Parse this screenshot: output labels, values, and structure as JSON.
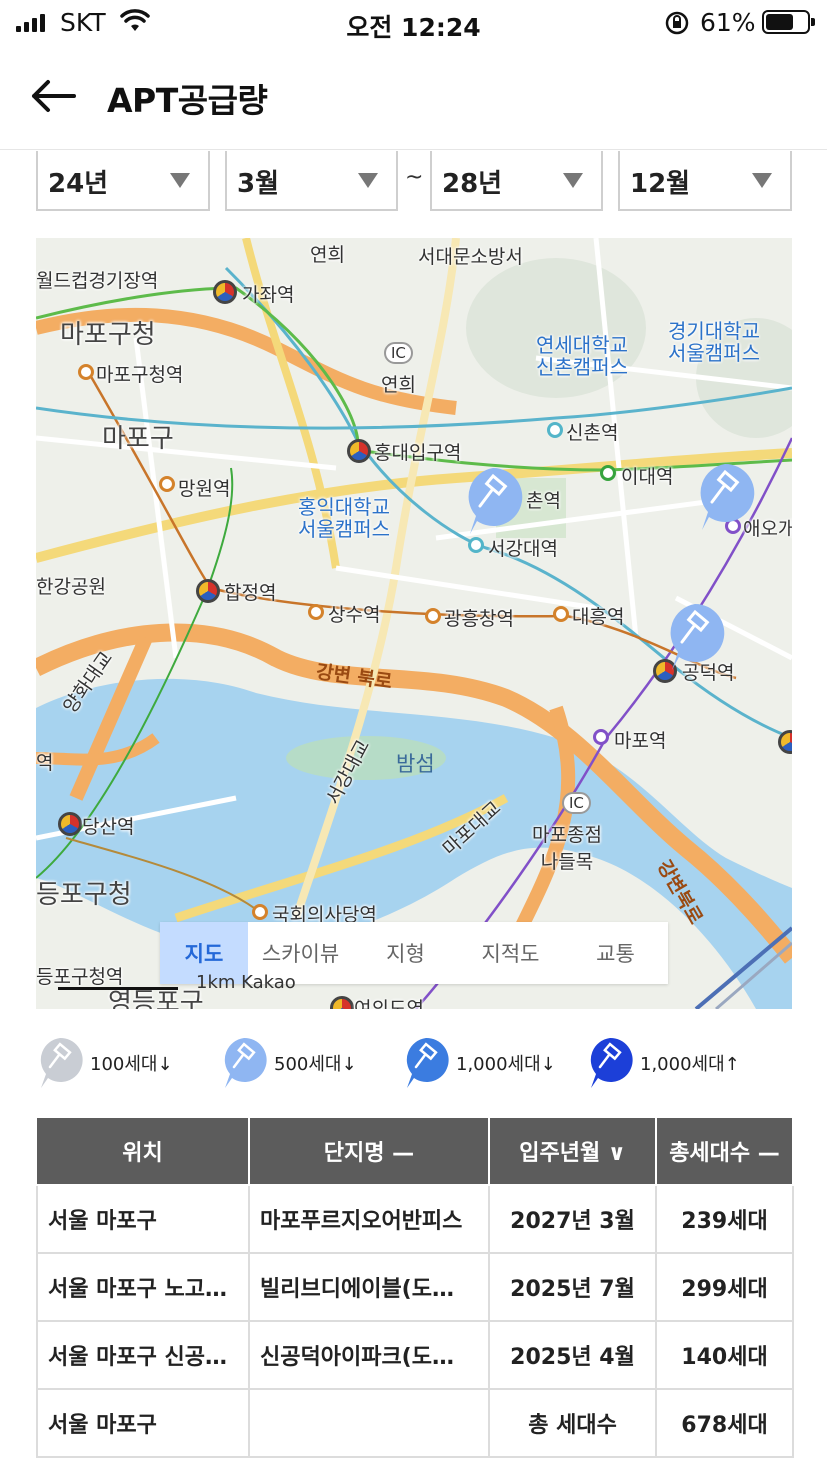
{
  "status_bar": {
    "carrier": "SKT",
    "time": "오전 12:24",
    "battery_percent": "61%",
    "battery_level": 0.61
  },
  "header": {
    "title": "APT공급량"
  },
  "filters": {
    "start_year": "24년",
    "start_month": "3월",
    "separator": "~",
    "end_year": "28년",
    "end_month": "12월"
  },
  "map": {
    "labels": {
      "yeonhui_top": "연희",
      "seodaemun_fire": "서대문소방서",
      "worldcup_stadium": "월드컵경기장역",
      "gajwa": "가좌역",
      "mapo_gu_office": "마포구청",
      "mapo_gu_office_stn": "마포구청역",
      "ic1": "IC",
      "yeonhui_ic": "연희",
      "yonsei": "연세대학교\n신촌캠퍼스",
      "kyonggi": "경기대학교\n서울캠퍼스",
      "mapo_gu": "마포구",
      "sinchon": "신촌역",
      "hongdae_stn": "홍대입구역",
      "mangwon": "망원역",
      "idae": "이대역",
      "hongik": "홍익대학교\n서울캠퍼스",
      "chon": "촌역",
      "aeogae": "애오개",
      "seogang": "서강대역",
      "hangang_park": "한강공원",
      "hapjeong": "합정역",
      "sangsu": "상수역",
      "gwangheungchang": "광흥창역",
      "daeheung": "대흥역",
      "gongdeok": "공덕역",
      "gangbyeon_north": "강변 북로",
      "yanghwa_bridge": "양화대교",
      "station_left": "역",
      "seogang_bridge": "서강대교",
      "bamseom": "밤섬",
      "mapo_stn": "마포역",
      "ic2": "IC",
      "mapo_bridge": "마포대교",
      "mapo_naru": "마포종점\n나들목",
      "dangsan": "당산역",
      "gangbyeon_north2": "강변북로",
      "yeongdeungpo_gu": "등포구청",
      "national_assembly": "국회의사당역",
      "yeongdeungpo_stn": "등포구청역",
      "yeongdeungpo": "영등포구",
      "yeouido": "여의도역",
      "scale": "1km  Kakao"
    },
    "tabs": [
      "지도",
      "스카이뷰",
      "지형",
      "지적도",
      "교통"
    ],
    "active_tab": "지도"
  },
  "legend": [
    {
      "label": "100세대↓",
      "color": "#c9cdd4"
    },
    {
      "label": "500세대↓",
      "color": "#8fb6f2"
    },
    {
      "label": "1,000세대↓",
      "color": "#3b7ce0"
    },
    {
      "label": "1,000세대↑",
      "color": "#1c3fd8"
    }
  ],
  "table": {
    "headers": [
      "위치",
      "단지명 —",
      "입주년월 ∨",
      "총세대수 —"
    ],
    "rows": [
      [
        "서울 마포구",
        "마포푸르지오어반피스",
        "2027년 3월",
        "239세대"
      ],
      [
        "서울 마포구 노고…",
        "빌리브디에이블(도…",
        "2025년 7월",
        "299세대"
      ],
      [
        "서울 마포구 신공…",
        "신공덕아이파크(도…",
        "2025년 4월",
        "140세대"
      ],
      [
        "서울 마포구",
        "",
        "총 세대수",
        "678세대"
      ]
    ]
  }
}
